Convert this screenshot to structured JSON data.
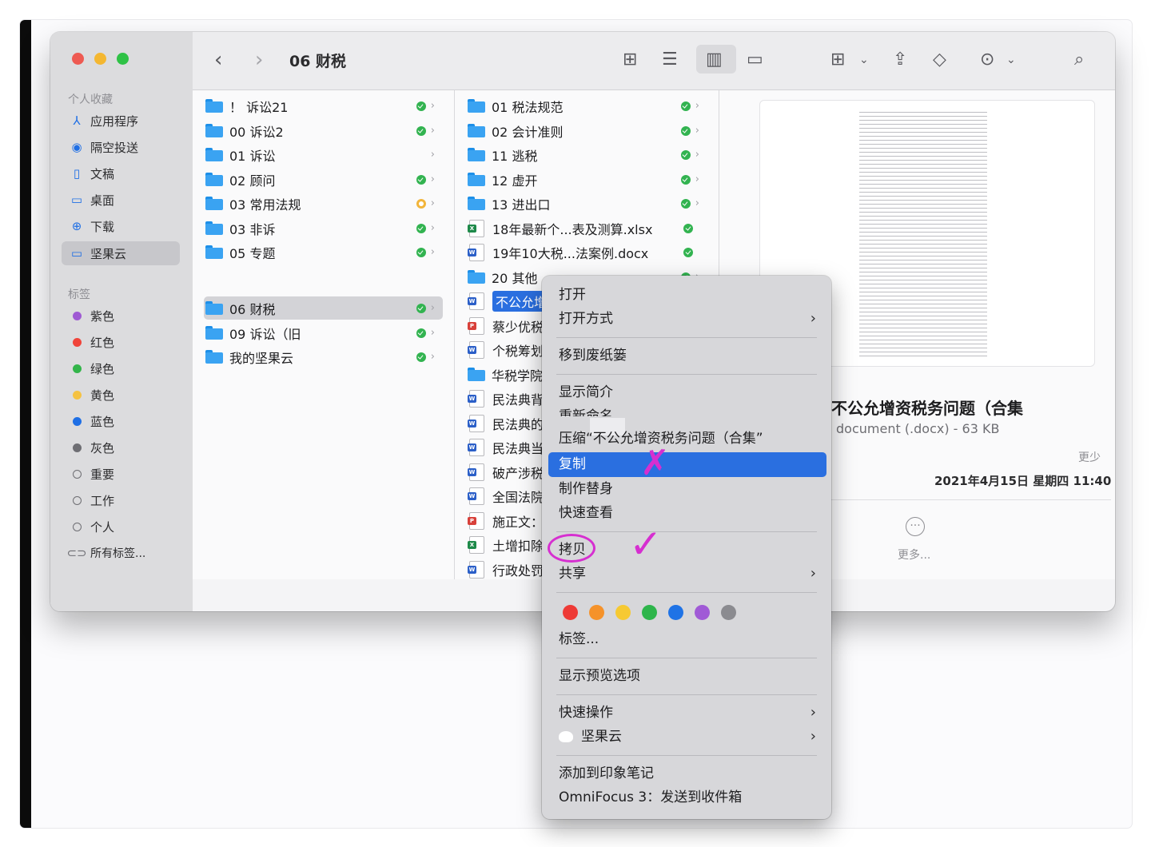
{
  "window": {
    "title": "06 财税"
  },
  "sidebar": {
    "favorites_heading": "个人收藏",
    "favorites": [
      {
        "label": "应用程序",
        "icon": "applications-icon"
      },
      {
        "label": "隔空投送",
        "icon": "airdrop-icon"
      },
      {
        "label": "文稿",
        "icon": "document-icon"
      },
      {
        "label": "桌面",
        "icon": "desktop-icon"
      },
      {
        "label": "下载",
        "icon": "downloads-icon"
      },
      {
        "label": "坚果云",
        "icon": "folder-icon"
      }
    ],
    "tags_heading": "标签",
    "tags": [
      {
        "label": "紫色",
        "color": "#9f5ad3"
      },
      {
        "label": "红色",
        "color": "#f0443a"
      },
      {
        "label": "绿色",
        "color": "#33b54a"
      },
      {
        "label": "黄色",
        "color": "#f5c242"
      },
      {
        "label": "蓝色",
        "color": "#1f6fe5"
      },
      {
        "label": "灰色",
        "color": "#6e6e73"
      },
      {
        "label": "重要",
        "color": ""
      },
      {
        "label": "工作",
        "color": ""
      },
      {
        "label": "个人",
        "color": ""
      },
      {
        "label": "所有标签...",
        "color": ""
      }
    ]
  },
  "column1": [
    {
      "label": "！ 诉讼21",
      "status": "synced"
    },
    {
      "label": "00 诉讼2",
      "status": "synced"
    },
    {
      "label": "01 诉讼",
      "status": "none"
    },
    {
      "label": "02 顾问",
      "status": "synced"
    },
    {
      "label": "03 常用法规",
      "status": "syncing"
    },
    {
      "label": "03 非诉",
      "status": "synced"
    },
    {
      "label": "05 专题",
      "status": "synced"
    },
    {
      "label": "06 财税",
      "status": "synced"
    },
    {
      "label": "09 诉讼（旧",
      "status": "synced"
    },
    {
      "label": "我的坚果云",
      "status": "synced"
    }
  ],
  "column2": [
    {
      "label": "01 税法规范",
      "kind": "folder"
    },
    {
      "label": "02 会计准则",
      "kind": "folder"
    },
    {
      "label": "11 逃税",
      "kind": "folder"
    },
    {
      "label": "12 虚开",
      "kind": "folder"
    },
    {
      "label": "13 进出口",
      "kind": "folder"
    },
    {
      "label": "18年最新个...表及测算.xlsx",
      "kind": "xlsx"
    },
    {
      "label": "19年10大税...法案例.docx",
      "kind": "docx"
    },
    {
      "label": "20 其他",
      "kind": "folder"
    },
    {
      "label": "不公允增资税务问题（合集）.docx",
      "kind": "docx"
    },
    {
      "label": "蔡少优税",
      "kind": "pdf"
    },
    {
      "label": "个税筹划",
      "kind": "docx"
    },
    {
      "label": "华税学院",
      "kind": "folder"
    },
    {
      "label": "民法典背",
      "kind": "docx"
    },
    {
      "label": "民法典的",
      "kind": "docx"
    },
    {
      "label": "民法典当",
      "kind": "docx"
    },
    {
      "label": "破产涉税",
      "kind": "docx"
    },
    {
      "label": "全国法院",
      "kind": "docx"
    },
    {
      "label": "施正文：",
      "kind": "pdf"
    },
    {
      "label": "土增扣除",
      "kind": "xlsx"
    },
    {
      "label": "行政处罚",
      "kind": "docx"
    }
  ],
  "preview": {
    "title": "不公允增资税务问题（合集",
    "subtitle": "document (.docx) - 63 KB",
    "less_label": "更少",
    "date": "2021年4月15日 星期四 11:40",
    "more_label": "更多..."
  },
  "context_menu": {
    "items": [
      {
        "label": "打开",
        "submenu": false
      },
      {
        "label": "打开方式",
        "submenu": true
      },
      {
        "label": "移到废纸篓",
        "submenu": false
      },
      {
        "label": "显示简介",
        "submenu": false
      },
      {
        "label": "重新命名",
        "submenu": false
      },
      {
        "label": "压缩“不公允增资税务问题（合集”",
        "submenu": false
      },
      {
        "label": "复制",
        "submenu": false,
        "highlighted": true
      },
      {
        "label": "制作替身",
        "submenu": false
      },
      {
        "label": "快速查看",
        "submenu": false
      },
      {
        "label": "拷贝",
        "submenu": false
      },
      {
        "label": "共享",
        "submenu": true
      },
      {
        "label": "标签...",
        "submenu": false
      },
      {
        "label": "显示预览选项",
        "submenu": false
      },
      {
        "label": "快速操作",
        "submenu": true
      },
      {
        "label": "坚果云",
        "submenu": true
      },
      {
        "label": "添加到印象笔记",
        "submenu": false
      },
      {
        "label": "OmniFocus 3：发送到收件箱",
        "submenu": false
      }
    ],
    "tag_colors": [
      "#ee3a36",
      "#f5922a",
      "#f6c932",
      "#2eb54b",
      "#1f73e6",
      "#a05ad6",
      "#8b8b90"
    ]
  },
  "annotations": {
    "cross_mark": "✗",
    "check_mark": "✓",
    "circle_color": "#d62fd0"
  }
}
